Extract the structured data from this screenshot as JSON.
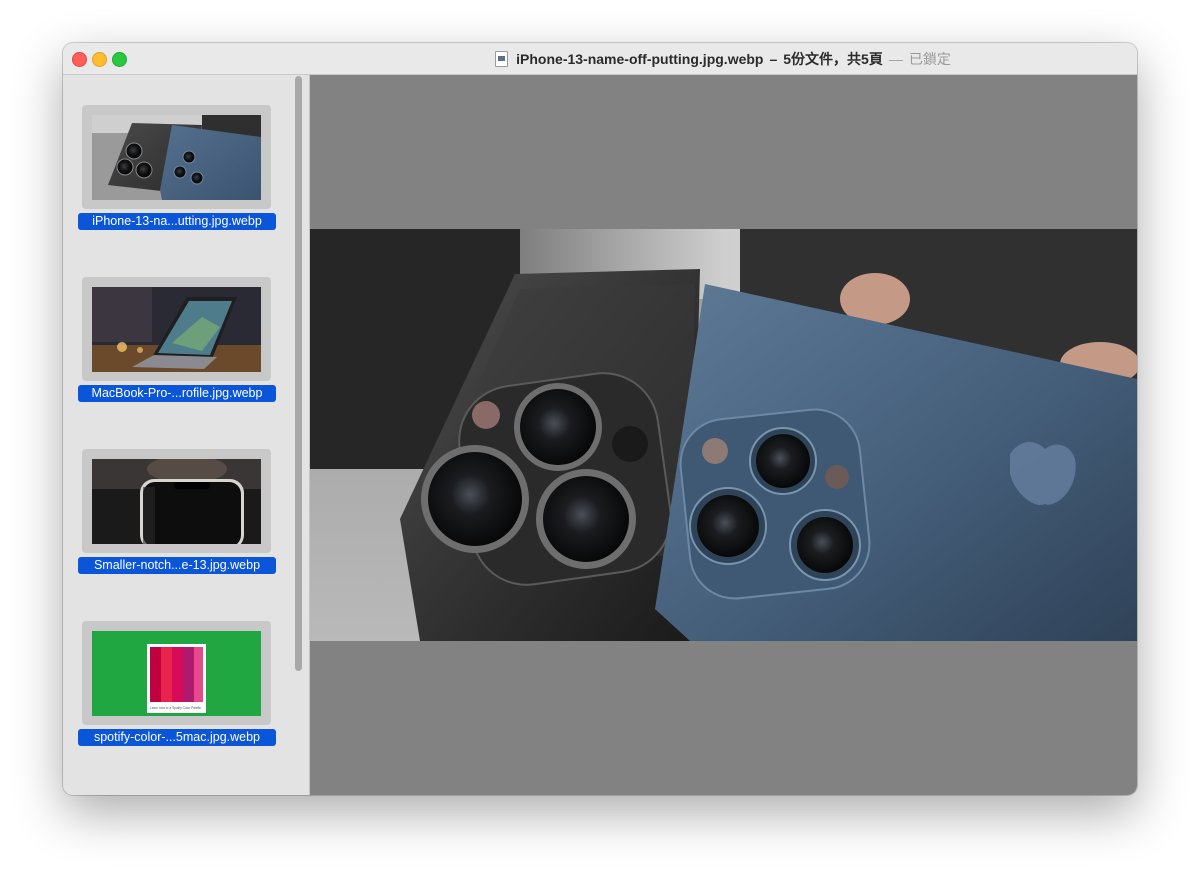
{
  "window": {
    "title_file": "iPhone-13-name-off-putting.jpg.webp",
    "title_dash": "–",
    "title_count": "5份文件，共5頁",
    "title_sep": "—",
    "title_status": "已鎖定"
  },
  "sidebar": {
    "items": [
      {
        "label": "iPhone-13-na...utting.jpg.webp",
        "image": "two-iphones-cameras"
      },
      {
        "label": "MacBook-Pro-...rofile.jpg.webp",
        "image": "macbook-on-desk"
      },
      {
        "label": "Smaller-notch...e-13.jpg.webp",
        "image": "iphone-notch-closeup"
      },
      {
        "label": "spotify-color-...5mac.jpg.webp",
        "image": "spotify-color-palette"
      }
    ],
    "spotify_caption": "Learn how to a Spotify Color Palette"
  },
  "preview": {
    "image": "two-iphones-cameras"
  },
  "colors": {
    "selection": "#0a55d8",
    "preview_background": "#828282",
    "close": "#ff5f57",
    "minimize": "#febc2e",
    "maximize": "#28c840"
  }
}
